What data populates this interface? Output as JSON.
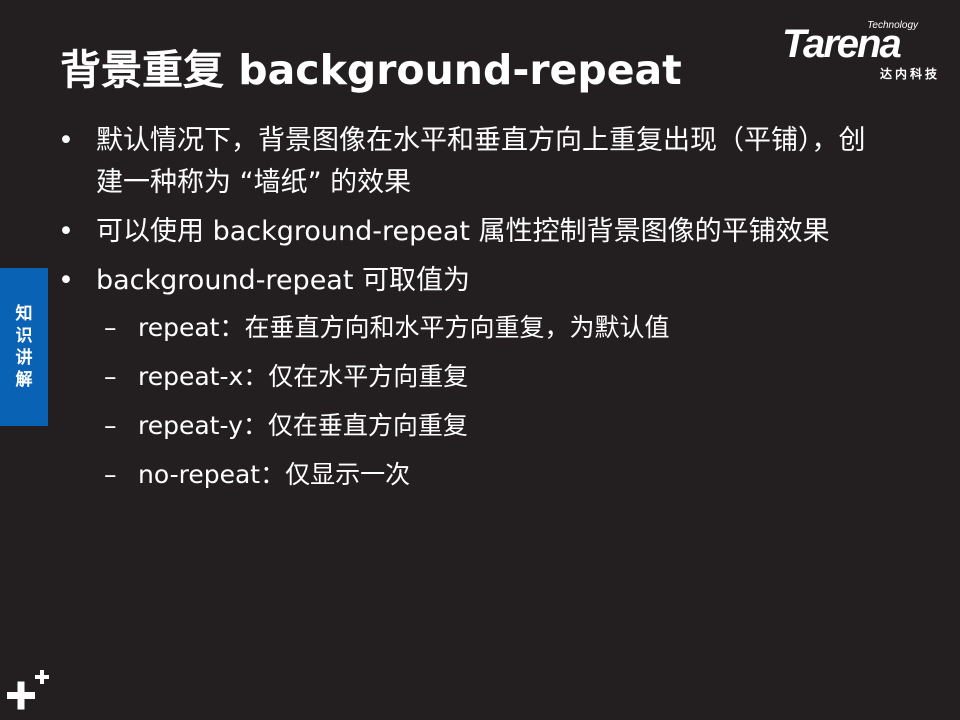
{
  "slide": {
    "title": "背景重复 background-repeat",
    "logo": {
      "technology": "Technology",
      "name": "Tarena",
      "chinese": "达内科技"
    },
    "side_tab": [
      "知",
      "识",
      "讲",
      "解"
    ],
    "bullets": [
      "默认情况下，背景图像在水平和垂直方向上重复出现（平铺），创建一种称为 “墙纸” 的效果",
      "可以使用 background-repeat 属性控制背景图像的平铺效果",
      "background-repeat 可取值为"
    ],
    "sub_bullets": [
      "repeat：在垂直方向和水平方向重复，为默认值",
      "repeat-x：仅在水平方向重复",
      "repeat-y：仅在垂直方向重复",
      "no-repeat：仅显示一次"
    ],
    "bullet_glyph": "•",
    "dash_glyph": "–"
  },
  "colors": {
    "background": "#231f20",
    "text": "#ffffff",
    "side_tab": "#0a62b5"
  }
}
